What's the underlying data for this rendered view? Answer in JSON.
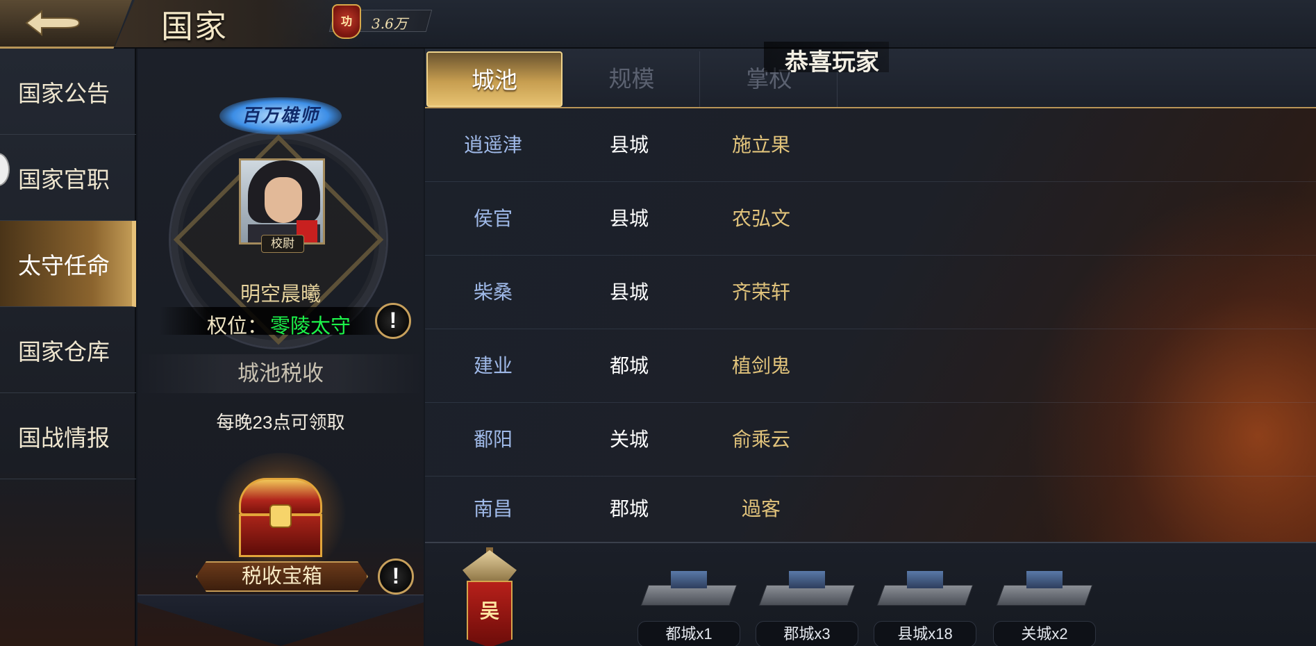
{
  "header": {
    "title": "国家",
    "power_badge": "功",
    "power_value": "3.6万"
  },
  "broadcast": "恭喜玩家",
  "nav": {
    "items": [
      {
        "label": "国家公告",
        "active": false
      },
      {
        "label": "国家官职",
        "active": false
      },
      {
        "label": "太守任命",
        "active": true
      },
      {
        "label": "国家仓库",
        "active": false
      },
      {
        "label": "国战情报",
        "active": false
      }
    ]
  },
  "character": {
    "title_badge": "百万雄师",
    "rank": "校尉",
    "name": "明空晨曦",
    "position_label": "权位：",
    "position_value": "零陵太守",
    "tax_header": "城池税收",
    "tax_note": "每晚23点可领取",
    "chest_button": "税收宝箱",
    "info_icon": "!"
  },
  "tabs": [
    {
      "label": "城池",
      "active": true
    },
    {
      "label": "规模",
      "active": false
    },
    {
      "label": "掌权",
      "active": false
    }
  ],
  "cities": [
    {
      "name": "逍遥津",
      "level": "县城",
      "governor": "施立果"
    },
    {
      "name": "侯官",
      "level": "县城",
      "governor": "农弘文"
    },
    {
      "name": "柴桑",
      "level": "县城",
      "governor": "齐荣轩"
    },
    {
      "name": "建业",
      "level": "都城",
      "governor": "植剑鬼"
    },
    {
      "name": "鄱阳",
      "level": "关城",
      "governor": "俞乘云"
    },
    {
      "name": "南昌",
      "level": "郡城",
      "governor": "過客"
    }
  ],
  "summary": {
    "emblem_char": "吴",
    "stats": [
      {
        "label": "都城x1"
      },
      {
        "label": "郡城x3"
      },
      {
        "label": "县城x18"
      },
      {
        "label": "关城x2"
      }
    ]
  },
  "colors": {
    "gold_accent": "#c79e50",
    "city_blue": "#9fb9e8",
    "governor_gold": "#e1c37b",
    "position_green": "#1cf34a"
  }
}
